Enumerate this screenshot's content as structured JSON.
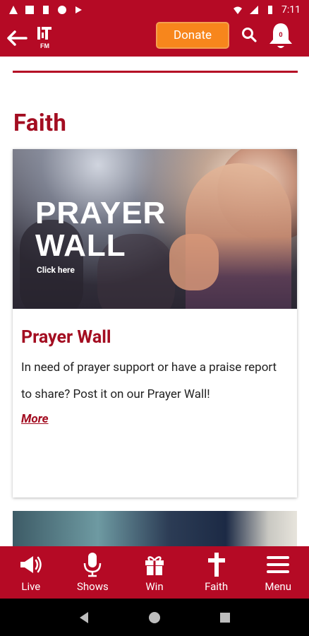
{
  "status_bar": {
    "time": "7:11"
  },
  "app_bar": {
    "donate_label": "Donate",
    "notification_count": "0",
    "logo_text": "TFM"
  },
  "section": {
    "title": "Faith"
  },
  "card": {
    "image_title": "PRAYER\nWALL",
    "image_subtitle": "Click here",
    "title": "Prayer Wall",
    "description": "In need of prayer support or have a praise report to share? Post it on our Prayer Wall!",
    "more_label": "More"
  },
  "bottom_nav": {
    "items": [
      {
        "label": "Live",
        "icon": "megaphone-icon"
      },
      {
        "label": "Shows",
        "icon": "microphone-icon"
      },
      {
        "label": "Win",
        "icon": "gift-icon"
      },
      {
        "label": "Faith",
        "icon": "cross-icon"
      },
      {
        "label": "Menu",
        "icon": "hamburger-icon"
      }
    ]
  },
  "colors": {
    "brand_red": "#b50a25",
    "title_red": "#a30d21",
    "donate_orange": "#f7861c"
  }
}
